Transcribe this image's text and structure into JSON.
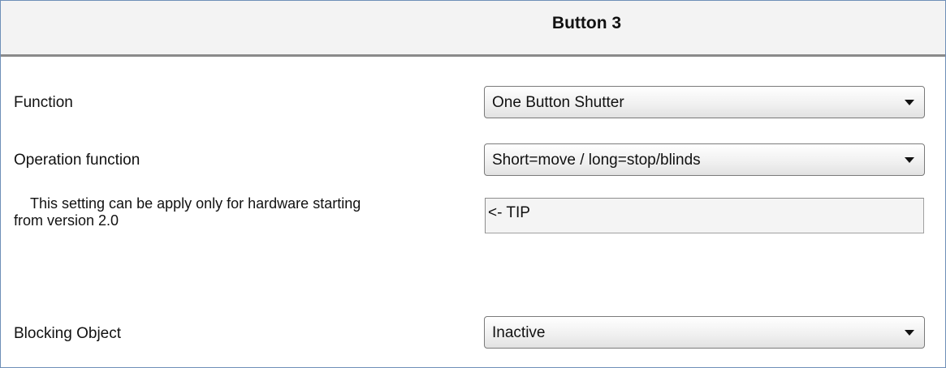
{
  "header": {
    "title": "Button 3"
  },
  "fields": {
    "function": {
      "label": "Function",
      "value": "One Button Shutter"
    },
    "operation_function": {
      "label": "Operation function",
      "value": "Short=move / long=stop/blinds"
    },
    "hardware_note": {
      "line1": "This setting can be apply only for hardware starting",
      "line2": "from version 2.0",
      "tip": "<- TIP"
    },
    "blocking_object": {
      "label": "Blocking Object",
      "value": "Inactive"
    }
  },
  "colors": {
    "header_background": "#f3f3f3",
    "header_separator": "#8a8a8a",
    "frame_border": "#6f8fb8"
  }
}
